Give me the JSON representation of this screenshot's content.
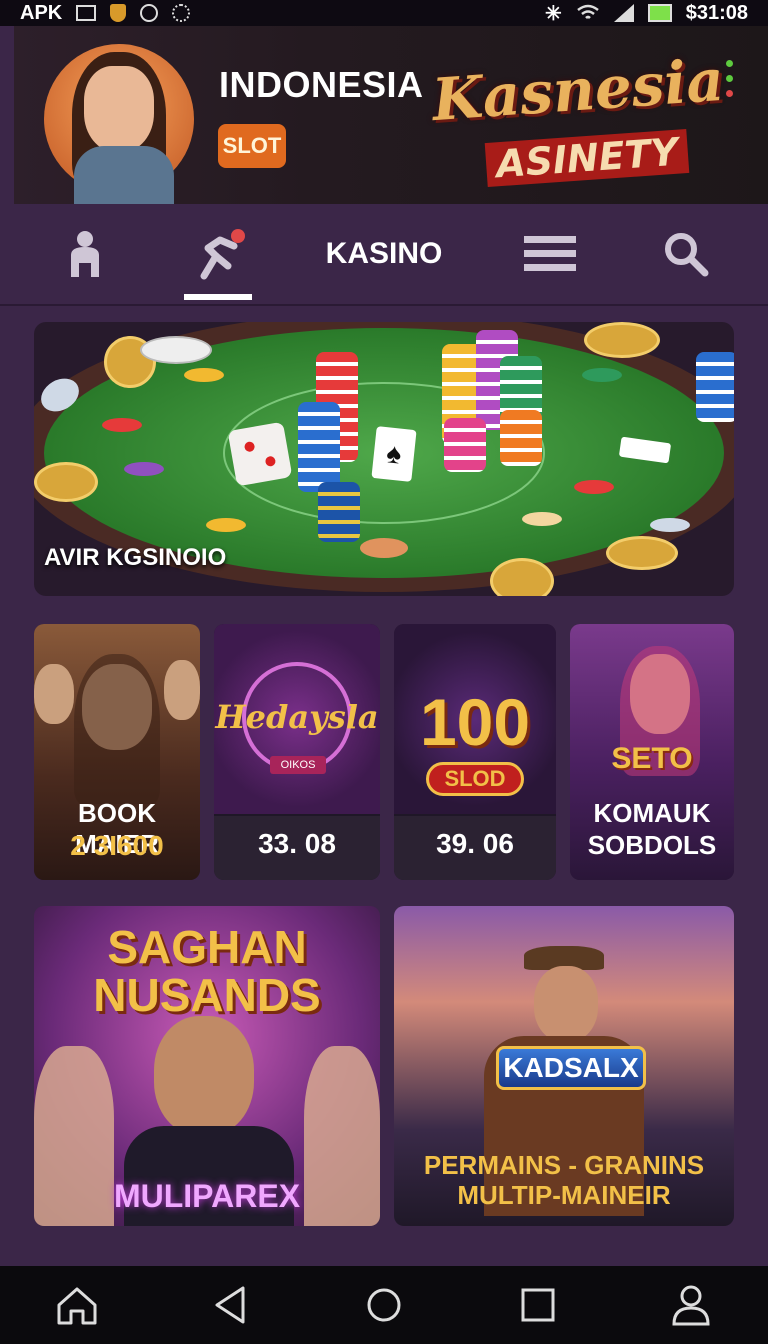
{
  "status_bar": {
    "left_text": "APK",
    "time": "$31:08",
    "icons": [
      "square-icon",
      "shield-icon",
      "circle-icon",
      "gear-icon"
    ],
    "right_icons": [
      "bluetooth-icon",
      "wifi-icon",
      "signal-icon",
      "battery-icon"
    ]
  },
  "header": {
    "title": "INDONESIA",
    "badge": "SLOT",
    "logo_line1": "Kasnesia",
    "logo_line2": "ASINETY",
    "menu_dots_colors": [
      "#5ecb3f",
      "#5ecb3f",
      "#e04848"
    ]
  },
  "tabs": {
    "items": [
      {
        "icon": "person-icon"
      },
      {
        "icon": "sports-icon",
        "active": true
      },
      {
        "label": "KASINO"
      },
      {
        "icon": "menu-icon"
      },
      {
        "icon": "search-icon"
      }
    ]
  },
  "hero": {
    "caption": "AVIR KGSINOIO"
  },
  "games_row": [
    {
      "title": "BOOK MAIER",
      "value": "2 3I600"
    },
    {
      "title": "Hedaysla",
      "subtitle": "OIKOS",
      "value": "33. 08"
    },
    {
      "title": "100",
      "subtitle": "SLOD",
      "value": "39. 06"
    },
    {
      "title": "SETO",
      "line1": "KOMAUK",
      "line2": "SOBDOLS"
    }
  ],
  "featured": [
    {
      "title_line1": "SAGHAN",
      "title_line2": "NUSANDS",
      "footer": "MULIPAREX"
    },
    {
      "badge": "KADSALX",
      "footer_line1": "PERMAINS - GRANINS",
      "footer_line2": "MULTIP-MAINEIR"
    }
  ],
  "colors": {
    "background": "#3b2648",
    "accent_orange": "#e06a1f",
    "gold": "#e9b25d"
  },
  "nav": [
    "home-icon",
    "back-icon",
    "home-circle-icon",
    "recent-apps-icon",
    "profile-icon"
  ]
}
